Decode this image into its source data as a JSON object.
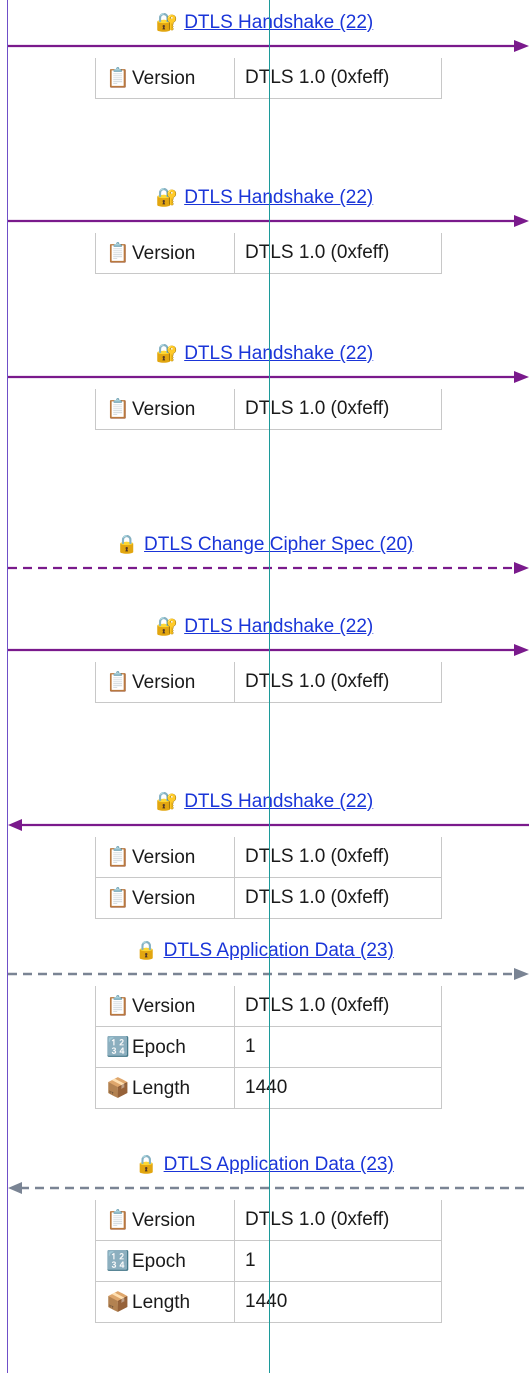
{
  "colors": {
    "handshake_arrow": "#7a1a8c",
    "dashed_handshake_arrow": "#7a1a8c",
    "appdata_arrow": "#7a8494",
    "link": "#1a35d8",
    "left_lifeline": "#6f4fc8",
    "center_lifeline": "#1c9a9a"
  },
  "messages": [
    {
      "title": "DTLS Handshake (22)",
      "icon": "locked-with-key-icon",
      "glyph": "🔐",
      "direction": "right",
      "style": "solid",
      "fields": [
        {
          "icon": "clipboard-icon",
          "glyph": "📋",
          "key": "Version",
          "value": "DTLS 1.0 (0xfeff)"
        }
      ]
    },
    {
      "title": "DTLS Handshake (22)",
      "icon": "locked-with-key-icon",
      "glyph": "🔐",
      "direction": "right",
      "style": "solid",
      "fields": [
        {
          "icon": "clipboard-icon",
          "glyph": "📋",
          "key": "Version",
          "value": "DTLS 1.0 (0xfeff)"
        }
      ]
    },
    {
      "title": "DTLS Handshake (22)",
      "icon": "locked-with-key-icon",
      "glyph": "🔐",
      "direction": "right",
      "style": "solid",
      "fields": [
        {
          "icon": "clipboard-icon",
          "glyph": "📋",
          "key": "Version",
          "value": "DTLS 1.0 (0xfeff)"
        }
      ]
    },
    {
      "title": "DTLS Change Cipher Spec (20)",
      "icon": "lock-icon",
      "glyph": "🔒",
      "direction": "right",
      "style": "dashed",
      "fields": []
    },
    {
      "title": "DTLS Handshake (22)",
      "icon": "locked-with-key-icon",
      "glyph": "🔐",
      "direction": "right",
      "style": "solid",
      "fields": [
        {
          "icon": "clipboard-icon",
          "glyph": "📋",
          "key": "Version",
          "value": "DTLS 1.0 (0xfeff)"
        }
      ]
    },
    {
      "title": "DTLS Handshake (22)",
      "icon": "locked-with-key-icon",
      "glyph": "🔐",
      "direction": "left",
      "style": "solid",
      "fields": [
        {
          "icon": "clipboard-icon",
          "glyph": "📋",
          "key": "Version",
          "value": "DTLS 1.0 (0xfeff)"
        },
        {
          "icon": "clipboard-icon",
          "glyph": "📋",
          "key": "Version",
          "value": "DTLS 1.0 (0xfeff)"
        }
      ]
    },
    {
      "title": "DTLS Application Data (23)",
      "icon": "lock-icon",
      "glyph": "🔒",
      "direction": "right",
      "style": "dashed-gray",
      "fields": [
        {
          "icon": "clipboard-icon",
          "glyph": "📋",
          "key": "Version",
          "value": "DTLS 1.0 (0xfeff)"
        },
        {
          "icon": "numbers-icon",
          "glyph": "🔢",
          "key": "Epoch",
          "value": "1"
        },
        {
          "icon": "package-icon",
          "glyph": "📦",
          "key": "Length",
          "value": "1440"
        }
      ]
    },
    {
      "title": "DTLS Application Data (23)",
      "icon": "lock-icon",
      "glyph": "🔒",
      "direction": "left",
      "style": "dashed-gray",
      "fields": [
        {
          "icon": "clipboard-icon",
          "glyph": "📋",
          "key": "Version",
          "value": "DTLS 1.0 (0xfeff)"
        },
        {
          "icon": "numbers-icon",
          "glyph": "🔢",
          "key": "Epoch",
          "value": "1"
        },
        {
          "icon": "package-icon",
          "glyph": "📦",
          "key": "Length",
          "value": "1440"
        }
      ]
    }
  ]
}
